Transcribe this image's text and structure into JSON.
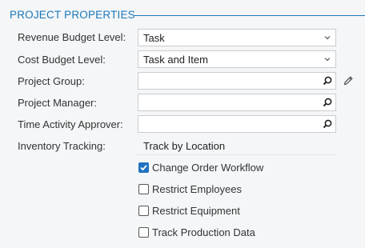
{
  "section": {
    "title": "PROJECT PROPERTIES"
  },
  "fields": {
    "revenue_budget_level": {
      "label": "Revenue Budget Level:",
      "value": "Task",
      "icon": "chevron-down-icon"
    },
    "cost_budget_level": {
      "label": "Cost Budget Level:",
      "value": "Task and Item",
      "icon": "chevron-down-icon"
    },
    "project_group": {
      "label": "Project Group:",
      "value": "",
      "icon": "search-icon",
      "extra_icon": "pencil-icon"
    },
    "project_manager": {
      "label": "Project Manager:",
      "value": "",
      "icon": "search-icon"
    },
    "time_activity_approver": {
      "label": "Time Activity Approver:",
      "value": "",
      "icon": "search-icon"
    },
    "inventory_tracking": {
      "label": "Inventory Tracking:",
      "value": "Track by Location"
    }
  },
  "checkboxes": [
    {
      "label": "Change Order Workflow",
      "checked": true
    },
    {
      "label": "Restrict Employees",
      "checked": false
    },
    {
      "label": "Restrict Equipment",
      "checked": false
    },
    {
      "label": "Track Production Data",
      "checked": false
    }
  ],
  "colors": {
    "accent": "#1d78b8",
    "checkbox_checked": "#1f72c0",
    "background": "#f4f6f8",
    "field_border": "#c9cdd1"
  }
}
